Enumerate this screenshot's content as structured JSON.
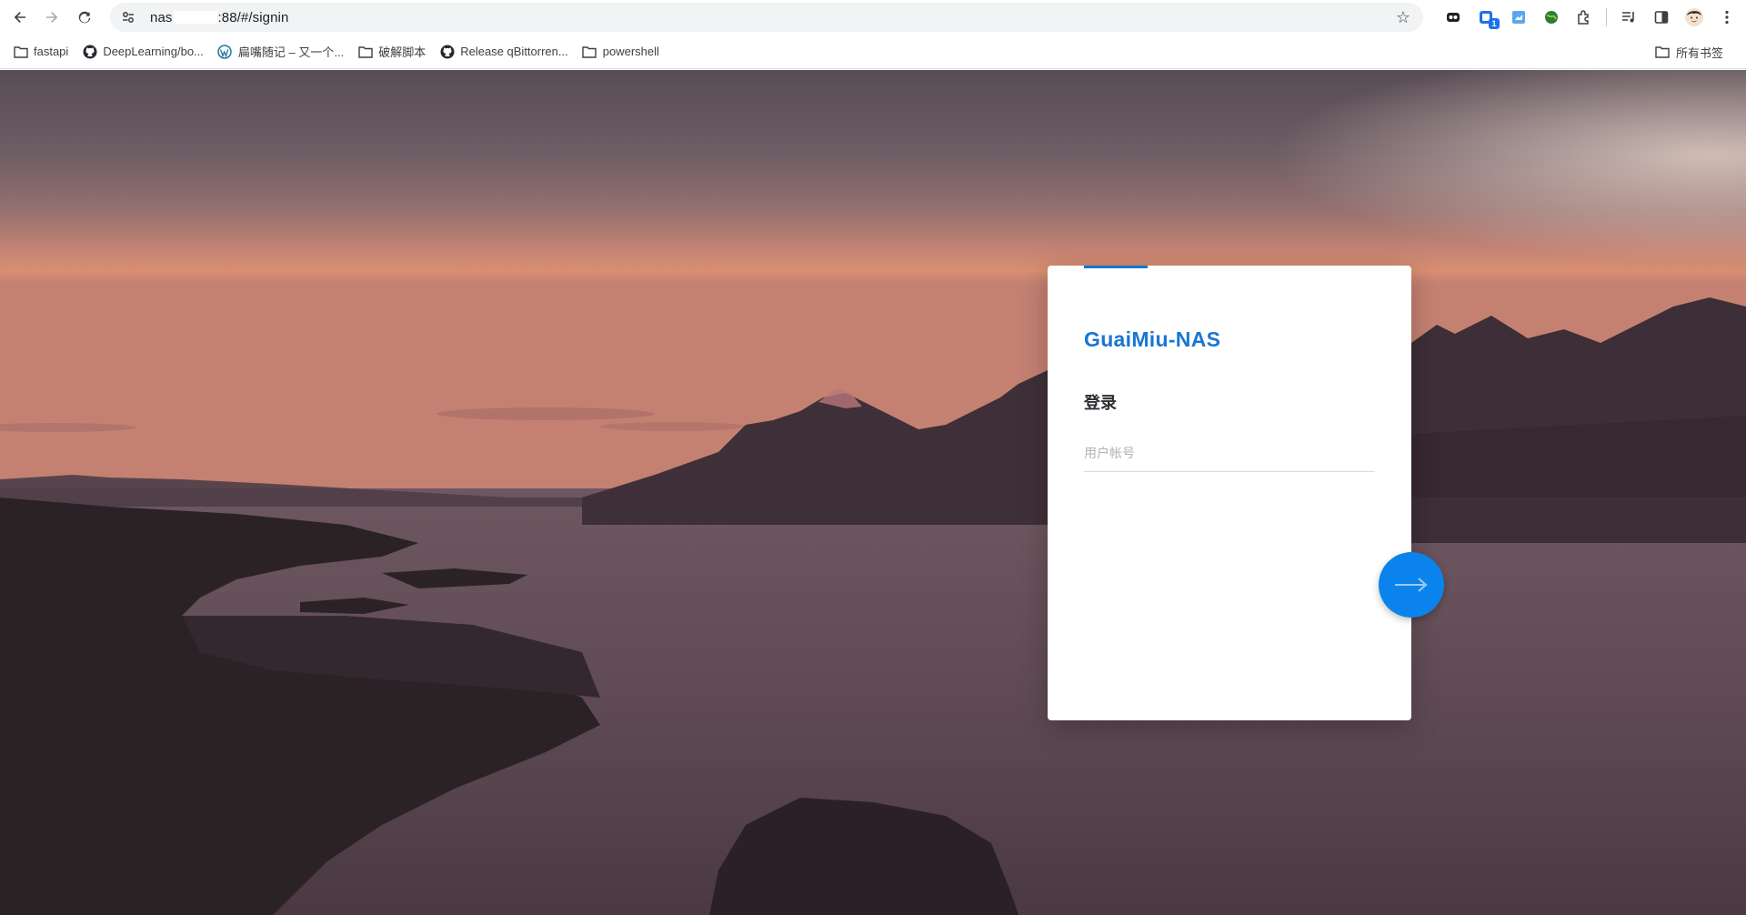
{
  "browser": {
    "url_prefix": "nas",
    "url_suffix": ":88/#/signin",
    "bookmarks": [
      {
        "label": "fastapi",
        "icon": "folder-icon"
      },
      {
        "label": "DeepLearning/bo...",
        "icon": "github-icon"
      },
      {
        "label": "扁嘴随记 – 又一个...",
        "icon": "wordpress-icon"
      },
      {
        "label": "破解脚本",
        "icon": "folder-icon"
      },
      {
        "label": "Release qBittorren...",
        "icon": "github-icon"
      },
      {
        "label": "powershell",
        "icon": "folder-icon"
      }
    ],
    "all_bookmarks_label": "所有书签",
    "extension_badge": "1"
  },
  "login": {
    "brand": "GuaiMiu-NAS",
    "heading": "登录",
    "username_placeholder": "用户帐号"
  },
  "colors": {
    "accent": "#1976d2",
    "button": "#0a84ec"
  }
}
